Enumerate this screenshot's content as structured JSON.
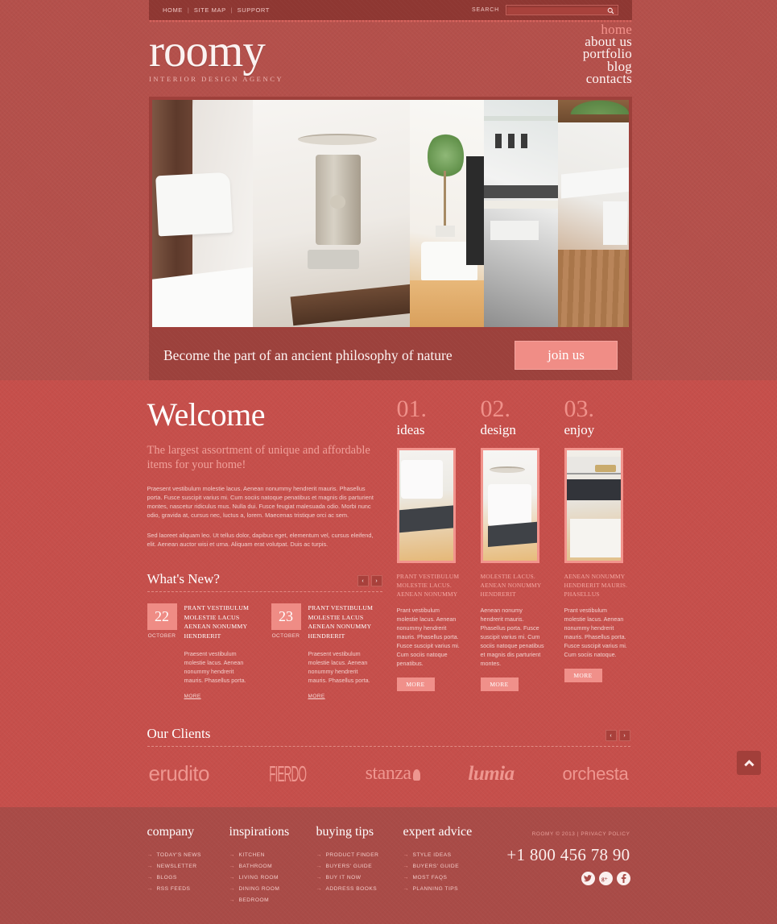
{
  "topbar": {
    "links": [
      "HOME",
      "SITE MAP",
      "SUPPORT"
    ],
    "separator": "|",
    "search_label": "SEARCH",
    "search_value": "",
    "search_placeholder": "",
    "search_icon": "search-icon"
  },
  "header": {
    "logo": "roomy",
    "tagline": "INTERIOR DESIGN AGENCY",
    "nav": [
      {
        "label": "home",
        "active": true
      },
      {
        "label": "about us",
        "active": false
      },
      {
        "label": "portfolio",
        "active": false
      },
      {
        "label": "blog",
        "active": false
      },
      {
        "label": "contacts",
        "active": false
      }
    ]
  },
  "slogan": {
    "text": "Become the part of an ancient philosophy of nature",
    "button": "join us"
  },
  "welcome": {
    "heading": "Welcome",
    "subheading": "The largest assortment of unique and affordable items for your home!",
    "paragraph1": "Praesent vestibulum molestie lacus. Aenean nonummy hendrerit mauris. Phasellus porta. Fusce suscipit varius mi. Cum sociis natoque penatibus et magnis dis parturient montes, nascetur ridiculus mus. Nulla dui. Fusce feugiat malesuada odio. Morbi nunc odio, gravida at, cursus nec, luctus a, lorem. Maecenas tristique orci ac sem.",
    "paragraph2": "Sed laoreet aliquam leo. Ut tellus dolor, dapibus eget, elementum vel, cursus eleifend, elit. Aenean auctor wisi et urna. Aliquam erat volutpat. Duis ac turpis."
  },
  "whats_new": {
    "title": "What's New?",
    "prev": "‹",
    "next": "›",
    "items": [
      {
        "day": "22",
        "month": "OCTOBER",
        "title": "PRANT VESTIBULUM MOLESTIE LACUS AENEAN NONUMMY HENDRERIT",
        "text": "Praesent vestibulum molestie lacus. Aenean nonummy hendrerit mauris. Phasellus porta.",
        "more": "MORE"
      },
      {
        "day": "23",
        "month": "OCTOBER",
        "title": "PRANT VESTIBULUM MOLESTIE LACUS AENEAN NONUMMY HENDRERIT",
        "text": "Praesent vestibulum molestie lacus. Aenean nonummy hendrerit mauris. Phasellus porta.",
        "more": "MORE"
      }
    ]
  },
  "features": [
    {
      "number": "01.",
      "name": "ideas",
      "caption": "PRANT VESTIBULUM MOLESTIE LACUS. AENEAN NONUMMY",
      "text": "Prant vestibulum molestie lacus. Aenean nonummy hendrerit mauris. Phasellus porta. Fusce suscipit varius mi. Cum sociis natoque penatibus.",
      "more": "MORE"
    },
    {
      "number": "02.",
      "name": "design",
      "caption": "MOLESTIE LACUS. AENEAN NONUMMY HENDRERIT",
      "text": "Aenean nonumy hendrerit mauris. Phasellus porta. Fusce suscipit varius mi. Cum sociis natoque penatibus et magnis dis parturient montes.",
      "more": "MORE"
    },
    {
      "number": "03.",
      "name": "enjoy",
      "caption": "AENEAN NONUMMY HENDRERIT MAURIS. PHASELLUS",
      "text": "Prant vestibulum molestie lacus. Aenean nonummy hendrerit mauris. Phasellus porta. Fusce suscipit varius mi. Cum sociis natoque.",
      "more": "MORE"
    }
  ],
  "clients": {
    "title": "Our Clients",
    "prev": "‹",
    "next": "›",
    "logos": [
      "erudito",
      "FIERDO",
      "stanza",
      "lumia",
      "orchesta"
    ]
  },
  "footer": {
    "columns": [
      {
        "title": "company",
        "items": [
          "TODAY'S NEWS",
          "NEWSLETTER",
          "BLOGS",
          "RSS FEEDS"
        ]
      },
      {
        "title": "inspirations",
        "items": [
          "KITCHEN",
          "BATHROOM",
          "LIVING ROOM",
          "DINING ROOM",
          "BEDROOM"
        ]
      },
      {
        "title": "buying tips",
        "items": [
          "PRODUCT FINDER",
          "BUYERS' GUIDE",
          "BUY IT NOW",
          "ADDRESS BOOKS"
        ]
      },
      {
        "title": "expert advice",
        "items": [
          "STYLE IDEAS",
          "BUYERS' GUIDE",
          "MOST FAQS",
          "PLANNING TIPS"
        ]
      }
    ],
    "copyright": "ROOMY © 2013  |  PRIVACY POLICY",
    "phone": "+1 800 456 78 90",
    "socials": [
      "twitter-icon",
      "google-plus-icon",
      "facebook-icon"
    ],
    "social_glyphs": [
      "ᵥ",
      "g",
      "f"
    ]
  },
  "colors": {
    "body_bg": "#b4504b",
    "topbar_bg": "#8e3732",
    "content_bg": "#c64f4b",
    "footer_bg": "#a94b47",
    "accent_pink": "#f0908a",
    "text_light": "#ffffff",
    "text_muted": "#f2cecb"
  }
}
